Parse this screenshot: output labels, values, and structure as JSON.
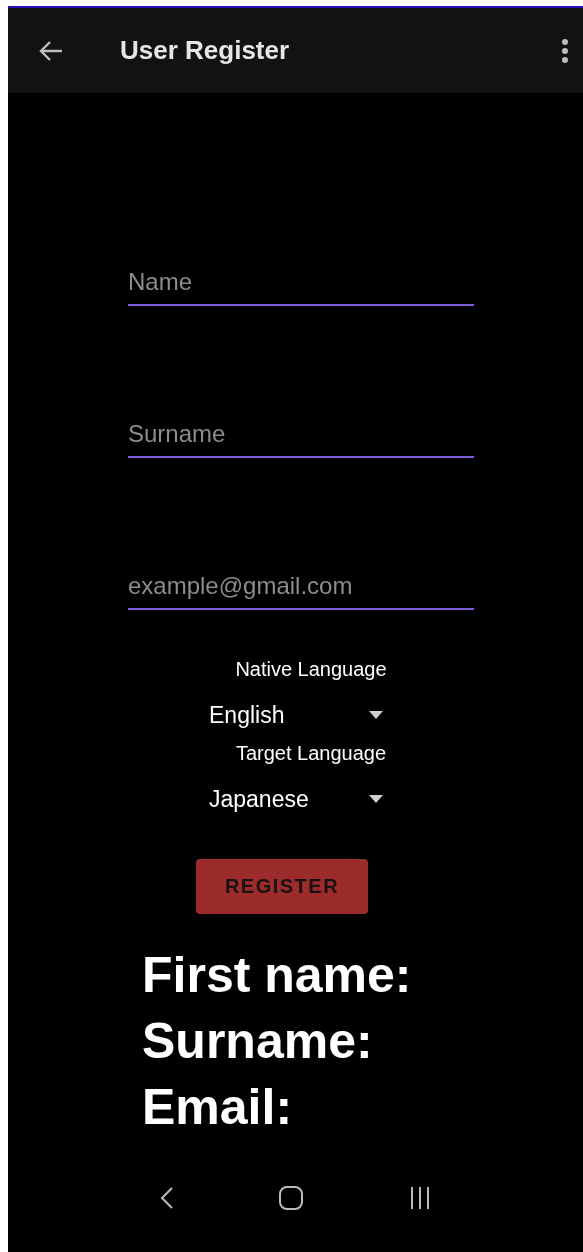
{
  "app_bar": {
    "title": "User Register"
  },
  "fields": [
    {
      "placeholder": "Name"
    },
    {
      "placeholder": "Surname"
    },
    {
      "placeholder": "example@gmail.com"
    }
  ],
  "pickers": [
    {
      "label": "Native Language",
      "value": "English"
    },
    {
      "label": "Target Language",
      "value": "Japanese"
    }
  ],
  "register_button": {
    "label": "REGISTER"
  },
  "info_lines": [
    "First name:",
    "Surname:",
    "Email:"
  ]
}
